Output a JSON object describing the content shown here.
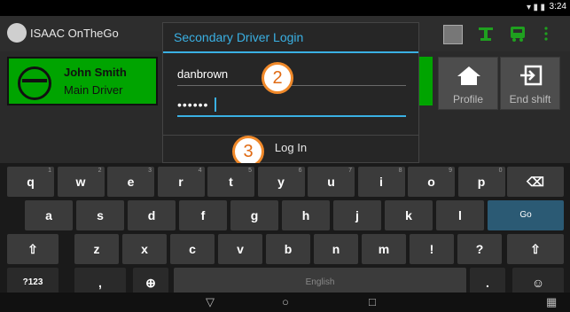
{
  "status_bar": {
    "time": "3:24"
  },
  "app": {
    "title": "ISAAC OnTheGo"
  },
  "driver_card": {
    "name": "John Smith",
    "role": "Main Driver"
  },
  "tiles": {
    "profile_label": "Profile",
    "end_shift_label": "End shift"
  },
  "dialog": {
    "title": "Secondary Driver Login",
    "username_value": "danbrown",
    "password_value": "••••••",
    "login_label": "Log In"
  },
  "annotations": {
    "step2": "2",
    "step3": "3"
  },
  "keyboard": {
    "row1": [
      [
        "q",
        "1"
      ],
      [
        "w",
        "2"
      ],
      [
        "e",
        "3"
      ],
      [
        "r",
        "4"
      ],
      [
        "t",
        "5"
      ],
      [
        "y",
        "6"
      ],
      [
        "u",
        "7"
      ],
      [
        "i",
        "8"
      ],
      [
        "o",
        "9"
      ],
      [
        "p",
        "0"
      ]
    ],
    "row2": [
      "a",
      "s",
      "d",
      "f",
      "g",
      "h",
      "j",
      "k",
      "l"
    ],
    "row3": [
      "z",
      "x",
      "c",
      "v",
      "b",
      "n",
      "m",
      "!",
      "?"
    ],
    "go_label": "Go",
    "sym_label": "?123",
    "comma_label": ",",
    "period_label": ".",
    "space_label": "English"
  },
  "colors": {
    "accent": "#3ab0e3",
    "driver_green": "#00a400",
    "annotation_orange": "#f0892a"
  }
}
